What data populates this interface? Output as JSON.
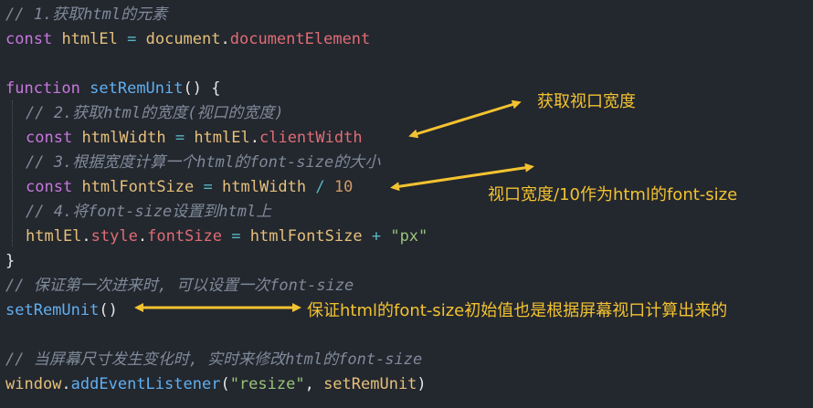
{
  "code": {
    "l1_comment": "// 1.获取html的元素",
    "l2_kw": "const",
    "l2_var": "htmlEl",
    "l2_op": "=",
    "l2_obj": "document",
    "l2_prop": "documentElement",
    "l4_kw": "function",
    "l4_fn": "setRemUnit",
    "l4_punct": "() {",
    "l5_comment": "// 2.获取html的宽度(视口的宽度)",
    "l6_kw": "const",
    "l6_var": "htmlWidth",
    "l6_op": "=",
    "l6_obj": "htmlEl",
    "l6_prop": "clientWidth",
    "l7_comment": "// 3.根据宽度计算一个html的font-size的大小",
    "l8_kw": "const",
    "l8_var": "htmlFontSize",
    "l8_op": "=",
    "l8_obj": "htmlWidth",
    "l8_div": "/",
    "l8_num": "10",
    "l9_comment": "// 4.将font-size设置到html上",
    "l10_obj": "htmlEl",
    "l10_prop1": "style",
    "l10_prop2": "fontSize",
    "l10_op": "=",
    "l10_var": "htmlFontSize",
    "l10_plus": "+",
    "l10_str": "\"px\"",
    "l11_punct": "}",
    "l12_comment": "// 保证第一次进来时, 可以设置一次font-size",
    "l13_fn": "setRemUnit",
    "l13_punct": "()",
    "l15_comment": "// 当屏幕尺寸发生变化时, 实时来修改html的font-size",
    "l16_obj": "window",
    "l16_fn": "addEventListener",
    "l16_str": "\"resize\"",
    "l16_arg": "setRemUnit"
  },
  "annotations": {
    "a1": "获取视口宽度",
    "a2": "视口宽度/10作为html的font-size",
    "a3": "保证html的font-size初始值也是根据屏幕视口计算出来的"
  },
  "colors": {
    "background": "#23272e",
    "annotation": "#f2c230",
    "keyword": "#c678dd",
    "function": "#61afef",
    "variable": "#e5c07b",
    "property": "#e06c75",
    "comment": "#7f8a99",
    "string": "#98c379",
    "number": "#d19a66"
  }
}
